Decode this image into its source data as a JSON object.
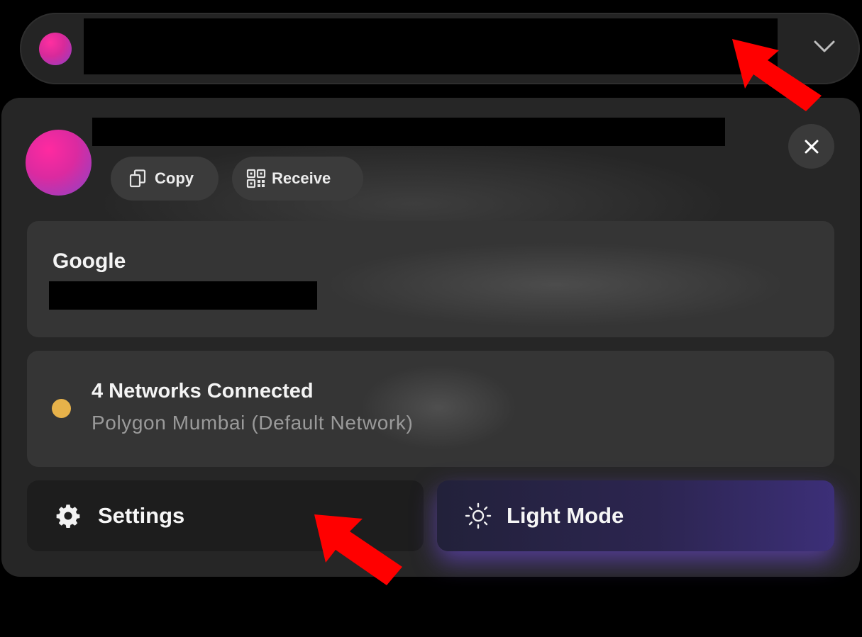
{
  "header": {
    "chevron_icon": "chevron-down-icon"
  },
  "account": {
    "copy_label": "Copy",
    "receive_label": "Receive",
    "close_icon": "close-icon",
    "copy_icon": "copy-icon",
    "receive_icon": "qr-code-icon"
  },
  "login": {
    "provider": "Google"
  },
  "network": {
    "title": "4 Networks Connected",
    "subtitle": "Polygon Mumbai (Default Network)",
    "status_color": "#e7b24a"
  },
  "actions": {
    "settings_label": "Settings",
    "settings_icon": "gear-icon",
    "light_mode_label": "Light Mode",
    "light_mode_icon": "sun-icon"
  },
  "colors": {
    "avatar_gradient_start": "#ff2aa0",
    "avatar_gradient_end": "#8a44c8",
    "light_mode_accent": "#7a50f0",
    "annotation_arrow": "#ff0000"
  }
}
